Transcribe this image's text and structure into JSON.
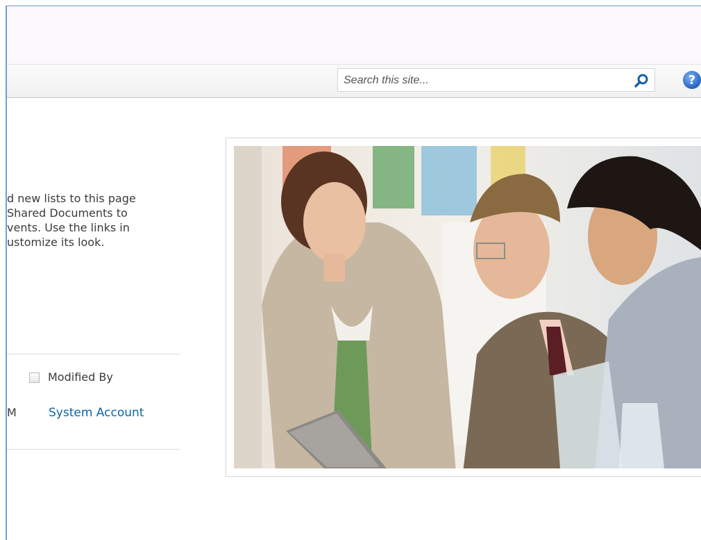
{
  "search": {
    "placeholder": "Search this site..."
  },
  "welcome": {
    "lines": [
      "d new lists to this page",
      " Shared Documents to",
      "vents. Use the links in",
      "ustomize its look."
    ]
  },
  "list": {
    "column_header": "Modified By",
    "row": {
      "partial_cell": "M",
      "modified_by": "System Account"
    }
  },
  "icons": {
    "search": "search-icon",
    "help": "help-icon"
  },
  "colors": {
    "border_accent": "#6f9fd8",
    "link": "#0c64a4",
    "help_blue": "#3a7bd5"
  }
}
